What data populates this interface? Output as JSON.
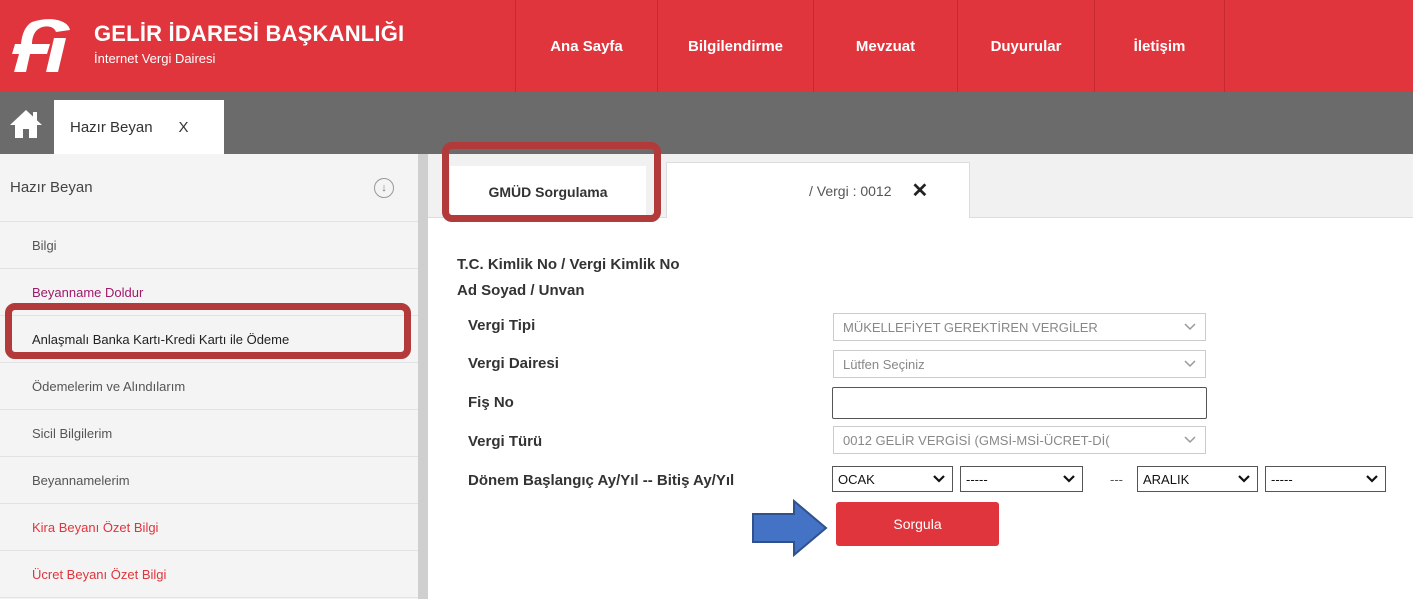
{
  "header": {
    "title": "GELİR İDARESİ BAŞKANLIĞI",
    "subtitle": "İnternet Vergi Dairesi",
    "brand_color": "#e0353c",
    "nav": [
      "Ana Sayfa",
      "Bilgilendirme",
      "Mevzuat",
      "Duyurular",
      "İletişim"
    ]
  },
  "tabstrip": {
    "home_icon": "home-icon",
    "tab_label": "Hazır Beyan",
    "tab_close": "X"
  },
  "sidebar": {
    "heading": "Hazır Beyan",
    "collapse_icon": "↓",
    "items": [
      {
        "label": "Bilgi"
      },
      {
        "label": "Beyanname Doldur"
      },
      {
        "label": "Anlaşmalı Banka Kartı-Kredi Kartı ile Ödeme"
      },
      {
        "label": "Ödemelerim ve Alındılarım"
      },
      {
        "label": "Sicil Bilgilerim"
      },
      {
        "label": "Beyannamelerim"
      },
      {
        "label": "Kira Beyanı Özet Bilgi"
      },
      {
        "label": "Ücret Beyanı Özet Bilgi"
      }
    ]
  },
  "content_tabs": {
    "active": "GMÜD Sorgulama",
    "second": "/ Vergi : 0012",
    "close": "✕"
  },
  "form": {
    "id_label": "T.C. Kimlik No / Vergi Kimlik No",
    "name_label": "Ad Soyad / Unvan",
    "vergi_tipi_label": "Vergi Tipi",
    "vergi_tipi_value": "MÜKELLEFİYET GEREKTİREN VERGİLER",
    "vergi_dairesi_label": "Vergi Dairesi",
    "vergi_dairesi_value": "Lütfen Seçiniz",
    "fis_no_label": "Fiş No",
    "fis_no_value": "",
    "vergi_turu_label": "Vergi Türü",
    "vergi_turu_value": "0012 GELİR VERGİSİ (GMSİ-MSİ-ÜCRET-Dİ(",
    "donem_label": "Dönem Başlangıç Ay/Yıl -- Bitiş Ay/Yıl",
    "start_month": "OCAK",
    "start_year": "-----",
    "range_sep": "---",
    "end_month": "ARALIK",
    "end_year": "-----",
    "submit": "Sorgula"
  }
}
